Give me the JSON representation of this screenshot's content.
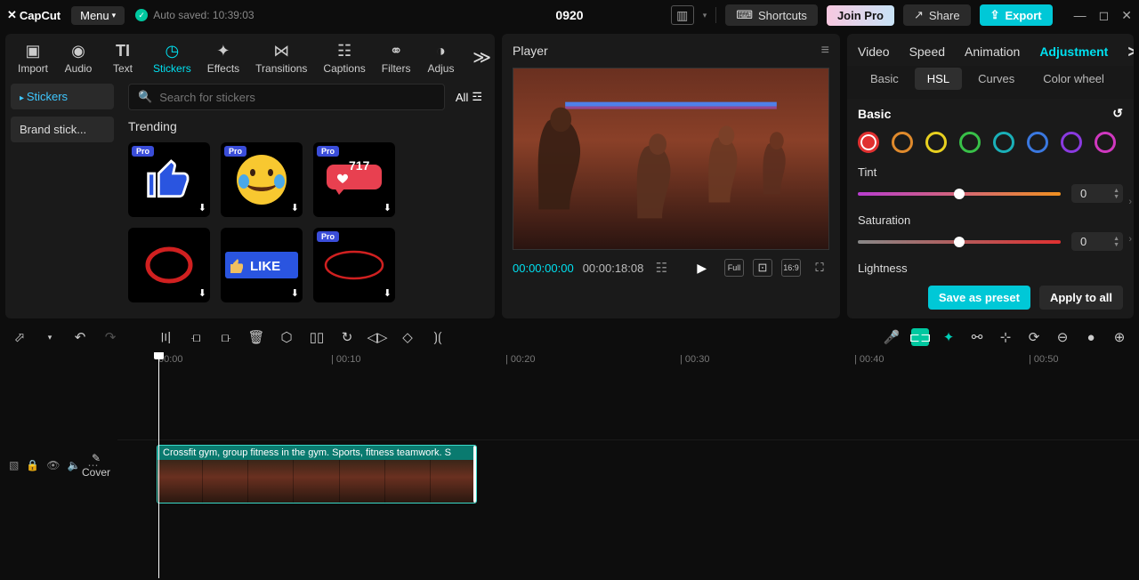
{
  "topbar": {
    "app": "CapCut",
    "menu": "Menu",
    "autosave": "Auto saved: 10:39:03",
    "project": "0920",
    "shortcuts": "Shortcuts",
    "joinpro": "Join Pro",
    "share": "Share",
    "export": "Export"
  },
  "sidepanel": {
    "tabs": [
      "Import",
      "Audio",
      "Text",
      "Stickers",
      "Effects",
      "Transitions",
      "Captions",
      "Filters",
      "Adjus"
    ],
    "active_tab": "Stickers",
    "categories": [
      "Stickers",
      "Brand stick..."
    ],
    "search_placeholder": "Search for stickers",
    "all": "All",
    "section": "Trending",
    "heart_count": "717",
    "like_text": "LIKE",
    "pro_tag": "Pro"
  },
  "player": {
    "title": "Player",
    "current": "00:00:00:00",
    "duration": "00:00:18:08",
    "ratio": "16:9",
    "full": "Full"
  },
  "inspector": {
    "tabs": [
      "Video",
      "Speed",
      "Animation",
      "Adjustment"
    ],
    "active_tab": "Adjustment",
    "subtabs": [
      "Basic",
      "HSL",
      "Curves",
      "Color wheel"
    ],
    "active_subtab": "HSL",
    "section": "Basic",
    "swatches": [
      "#e03030",
      "#e08a2c",
      "#e8d020",
      "#38c048",
      "#1ab0b8",
      "#3a78e0",
      "#8a3ae0",
      "#d038c0"
    ],
    "tint_label": "Tint",
    "tint_value": "0",
    "sat_label": "Saturation",
    "sat_value": "0",
    "light_label": "Lightness",
    "save_preset": "Save as preset",
    "apply_all": "Apply to all"
  },
  "timeline": {
    "ruler": [
      "00:00",
      "| 00:10",
      "| 00:20",
      "| 00:30",
      "| 00:40",
      "| 00:50"
    ],
    "clip_title": "Crossfit gym, group fitness in the gym. Sports, fitness teamwork. S",
    "cover": "Cover"
  }
}
